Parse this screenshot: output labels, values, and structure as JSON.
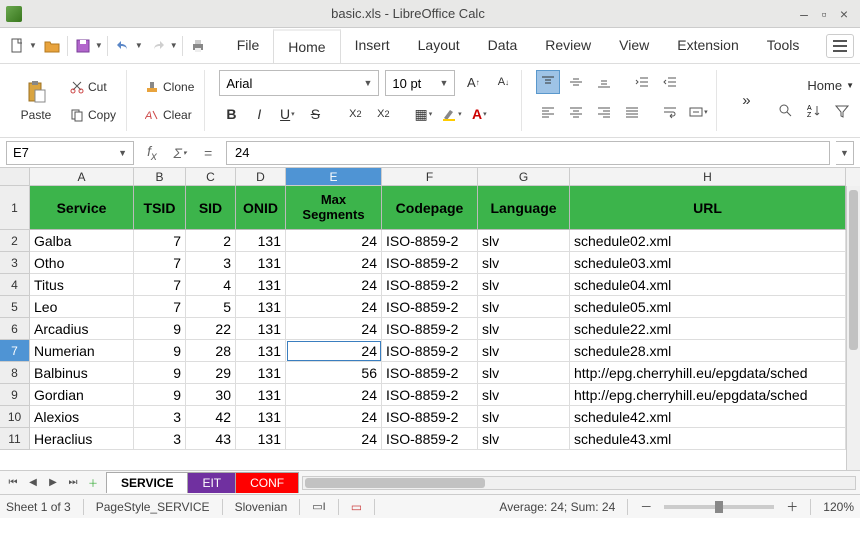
{
  "window": {
    "title": "basic.xls - LibreOffice Calc"
  },
  "menu": {
    "items": [
      "File",
      "Home",
      "Insert",
      "Layout",
      "Data",
      "Review",
      "View",
      "Extension",
      "Tools"
    ],
    "active": 1
  },
  "ribbon": {
    "paste": "Paste",
    "cut": "Cut",
    "copy": "Copy",
    "clone": "Clone",
    "clear": "Clear",
    "font_name": "Arial",
    "font_size": "10 pt",
    "home_label": "Home"
  },
  "formula": {
    "cell_ref": "E7",
    "value": "24"
  },
  "columns": [
    "A",
    "B",
    "C",
    "D",
    "E",
    "F",
    "G",
    "H"
  ],
  "selected_col": 4,
  "selected_row_index": 6,
  "header_row": [
    "Service",
    "TSID",
    "SID",
    "ONID",
    "Max\nSegments",
    "Codepage",
    "Language",
    "URL"
  ],
  "rows": [
    {
      "n": 2,
      "cells": [
        "Galba",
        "7",
        "2",
        "131",
        "24",
        "ISO-8859-2",
        "slv",
        "schedule02.xml"
      ]
    },
    {
      "n": 3,
      "cells": [
        "Otho",
        "7",
        "3",
        "131",
        "24",
        "ISO-8859-2",
        "slv",
        "schedule03.xml"
      ]
    },
    {
      "n": 4,
      "cells": [
        "Titus",
        "7",
        "4",
        "131",
        "24",
        "ISO-8859-2",
        "slv",
        "schedule04.xml"
      ]
    },
    {
      "n": 5,
      "cells": [
        "Leo",
        "7",
        "5",
        "131",
        "24",
        "ISO-8859-2",
        "slv",
        "schedule05.xml"
      ]
    },
    {
      "n": 6,
      "cells": [
        "Arcadius",
        "9",
        "22",
        "131",
        "24",
        "ISO-8859-2",
        "slv",
        "schedule22.xml"
      ]
    },
    {
      "n": 7,
      "cells": [
        "Numerian",
        "9",
        "28",
        "131",
        "24",
        "ISO-8859-2",
        "slv",
        "schedule28.xml"
      ]
    },
    {
      "n": 8,
      "cells": [
        "Balbinus",
        "9",
        "29",
        "131",
        "56",
        "ISO-8859-2",
        "slv",
        "http://epg.cherryhill.eu/epgdata/sched"
      ]
    },
    {
      "n": 9,
      "cells": [
        "Gordian",
        "9",
        "30",
        "131",
        "24",
        "ISO-8859-2",
        "slv",
        "http://epg.cherryhill.eu/epgdata/sched"
      ]
    },
    {
      "n": 10,
      "cells": [
        "Alexios",
        "3",
        "42",
        "131",
        "24",
        "ISO-8859-2",
        "slv",
        "schedule42.xml"
      ]
    },
    {
      "n": 11,
      "cells": [
        "Heraclius",
        "3",
        "43",
        "131",
        "24",
        "ISO-8859-2",
        "slv",
        "schedule43.xml"
      ]
    }
  ],
  "sheet_tabs": [
    {
      "name": "SERVICE",
      "cls": "active"
    },
    {
      "name": "EIT",
      "cls": "purple"
    },
    {
      "name": "CONF",
      "cls": "red"
    }
  ],
  "status": {
    "sheet_pos": "Sheet 1 of 3",
    "page_style": "PageStyle_SERVICE",
    "language": "Slovenian",
    "avg_sum": "Average: 24; Sum: 24",
    "zoom": "120%"
  }
}
